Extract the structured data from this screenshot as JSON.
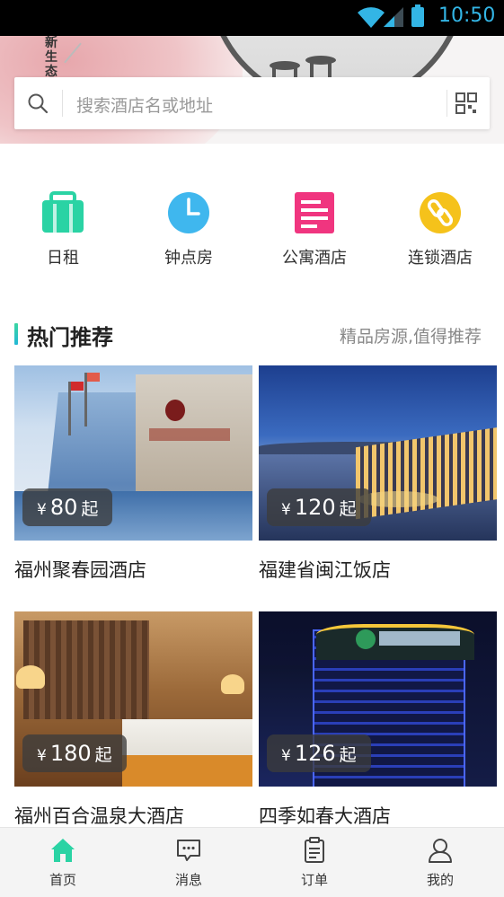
{
  "status_bar": {
    "time": "10:50"
  },
  "banner": {
    "vertical_text": "新生态"
  },
  "search": {
    "placeholder": "搜索酒店名或地址"
  },
  "categories": [
    {
      "label": "日租",
      "icon": "suitcase-icon",
      "color": "#2ad3a4"
    },
    {
      "label": "钟点房",
      "icon": "clock-icon",
      "color": "#3fb7ee"
    },
    {
      "label": "公寓酒店",
      "icon": "document-icon",
      "color": "#f0357f"
    },
    {
      "label": "连锁酒店",
      "icon": "chain-link-icon",
      "color": "#f5c21b"
    }
  ],
  "section": {
    "title": "热门推荐",
    "subtitle": "精品房源,值得推荐"
  },
  "hotels": [
    {
      "name": "福州聚春园酒店",
      "currency": "¥",
      "price": "80",
      "suffix": "起"
    },
    {
      "name": "福建省闽江饭店",
      "currency": "¥",
      "price": "120",
      "suffix": "起"
    },
    {
      "name": "福州百合温泉大酒店",
      "currency": "¥",
      "price": "180",
      "suffix": "起"
    },
    {
      "name": "四季如春大酒店",
      "currency": "¥",
      "price": "126",
      "suffix": "起"
    }
  ],
  "tabs": [
    {
      "label": "首页",
      "icon": "home-icon",
      "active": true
    },
    {
      "label": "消息",
      "icon": "message-icon",
      "active": false
    },
    {
      "label": "订单",
      "icon": "order-icon",
      "active": false
    },
    {
      "label": "我的",
      "icon": "user-icon",
      "active": false
    }
  ],
  "colors": {
    "accent": "#2ad3a4",
    "status_blue": "#33b5e5"
  }
}
